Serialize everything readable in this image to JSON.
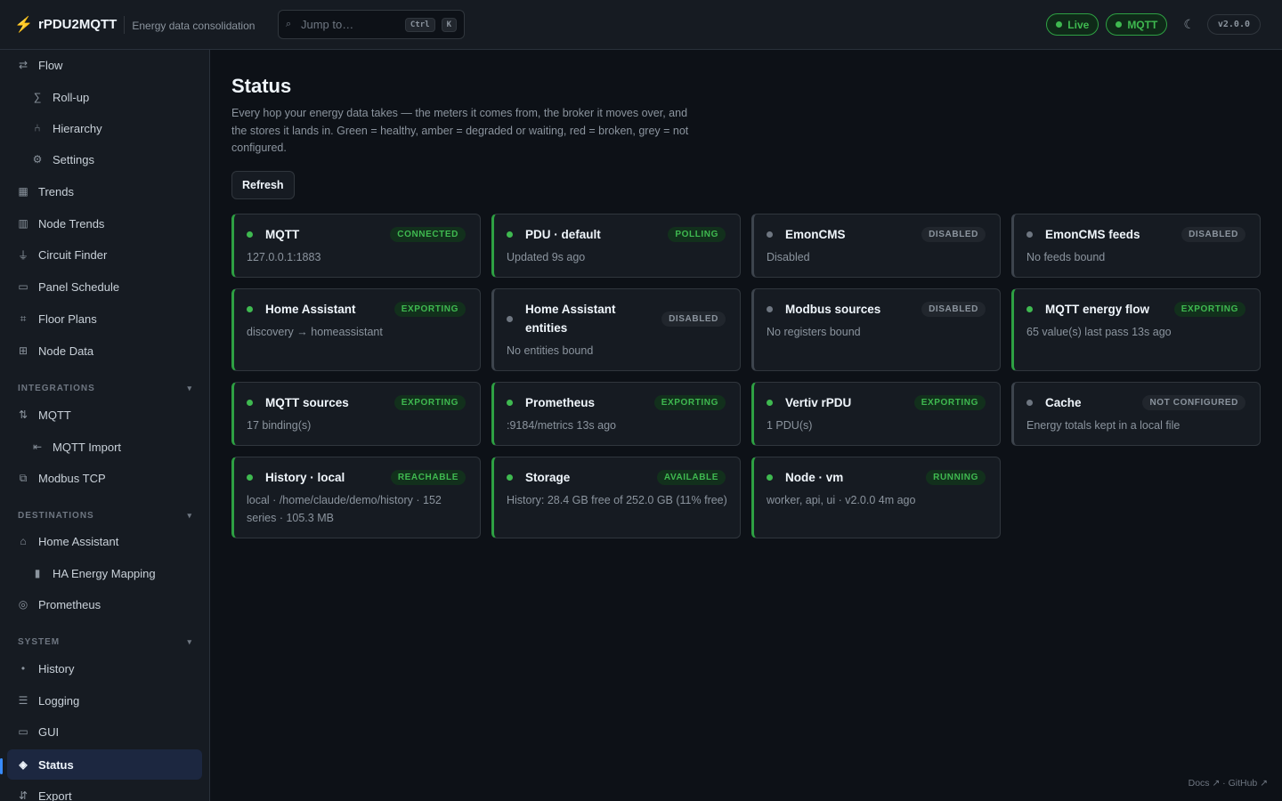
{
  "header": {
    "logo_icon": "lightning-bolt-icon",
    "app_name": "rPDU2MQTT",
    "subtitle": "Energy data consolidation",
    "search": {
      "placeholder": "Jump to…",
      "shortcut_ctrl": "Ctrl",
      "shortcut_key": "K"
    },
    "live_label": "Live",
    "mqtt_label": "MQTT",
    "theme_icon": "moon-icon",
    "version": "v2.0.0"
  },
  "sidebar": {
    "top_items": [
      {
        "label": "Flow",
        "icon": "arrows-exchange-icon"
      },
      {
        "label": "Roll-up",
        "icon": "sigma-icon"
      },
      {
        "label": "Hierarchy",
        "icon": "tree-icon"
      },
      {
        "label": "Settings",
        "icon": "gear-icon"
      },
      {
        "label": "Trends",
        "icon": "chart-grid-icon"
      },
      {
        "label": "Node Trends",
        "icon": "bar-chart-icon"
      },
      {
        "label": "Circuit Finder",
        "icon": "plug-icon"
      },
      {
        "label": "Panel Schedule",
        "icon": "folder-icon"
      },
      {
        "label": "Floor Plans",
        "icon": "floorplan-icon"
      },
      {
        "label": "Node Data",
        "icon": "table-icon"
      }
    ],
    "sections": [
      {
        "title": "INTEGRATIONS",
        "items": [
          {
            "label": "MQTT",
            "icon": "up-down-arrows-icon"
          },
          {
            "label": "MQTT Import",
            "icon": "import-icon"
          },
          {
            "label": "Modbus TCP",
            "icon": "copy-icon"
          }
        ]
      },
      {
        "title": "DESTINATIONS",
        "items": [
          {
            "label": "Home Assistant",
            "icon": "home-icon"
          },
          {
            "label": "HA Energy Mapping",
            "icon": "battery-icon"
          },
          {
            "label": "Prometheus",
            "icon": "target-icon"
          }
        ]
      },
      {
        "title": "SYSTEM",
        "items": [
          {
            "label": "History",
            "icon": "dot-icon"
          },
          {
            "label": "Logging",
            "icon": "list-icon"
          },
          {
            "label": "GUI",
            "icon": "window-icon"
          },
          {
            "label": "Status",
            "icon": "diamond-icon"
          },
          {
            "label": "Export",
            "icon": "export-icon"
          }
        ]
      }
    ]
  },
  "page": {
    "title": "Status",
    "description": "Every hop your energy data takes — the meters it comes from, the broker it moves over, and the stores it lands in. Green = healthy, amber = degraded or waiting, red = broken, grey = not configured.",
    "refresh_label": "Refresh"
  },
  "status_colors": {
    "healthy": "#3fb950",
    "inactive": "#6e7681"
  },
  "cards": [
    {
      "name": "MQTT",
      "badge": "CONNECTED",
      "detail": "127.0.0.1:1883",
      "state": "healthy"
    },
    {
      "name": "PDU · default",
      "badge": "POLLING",
      "detail": "Updated 9s ago",
      "state": "healthy"
    },
    {
      "name": "EmonCMS",
      "badge": "DISABLED",
      "detail": "Disabled",
      "state": "inactive"
    },
    {
      "name": "EmonCMS feeds",
      "badge": "DISABLED",
      "detail": "No feeds bound",
      "state": "inactive"
    },
    {
      "name": "Home Assistant",
      "badge": "EXPORTING",
      "detail": "discovery → homeassistant",
      "state": "healthy"
    },
    {
      "name": "Home Assistant entities",
      "badge": "DISABLED",
      "detail": "No entities bound",
      "state": "inactive"
    },
    {
      "name": "Modbus sources",
      "badge": "DISABLED",
      "detail": "No registers bound",
      "state": "inactive"
    },
    {
      "name": "MQTT energy flow",
      "badge": "EXPORTING",
      "detail": "65 value(s) last pass 13s ago",
      "state": "healthy"
    },
    {
      "name": "MQTT sources",
      "badge": "EXPORTING",
      "detail": "17 binding(s)",
      "state": "healthy"
    },
    {
      "name": "Prometheus",
      "badge": "EXPORTING",
      "detail": ":9184/metrics 13s ago",
      "state": "healthy"
    },
    {
      "name": "Vertiv rPDU",
      "badge": "EXPORTING",
      "detail": "1 PDU(s)",
      "state": "healthy"
    },
    {
      "name": "Cache",
      "badge": "NOT CONFIGURED",
      "detail": "Energy totals kept in a local file",
      "state": "inactive"
    },
    {
      "name": "History · local",
      "badge": "REACHABLE",
      "detail": "local · /home/claude/demo/history · 152 series · 105.3 MB",
      "state": "healthy"
    },
    {
      "name": "Storage",
      "badge": "AVAILABLE",
      "detail": "History: 28.4 GB free of 252.0 GB (11% free)",
      "state": "healthy"
    },
    {
      "name": "Node · vm",
      "badge": "RUNNING",
      "detail": "worker, api, ui · v2.0.0 4m ago",
      "state": "healthy"
    }
  ],
  "footer": {
    "docs": "Docs ↗",
    "separator": "·",
    "github": "GitHub ↗"
  }
}
